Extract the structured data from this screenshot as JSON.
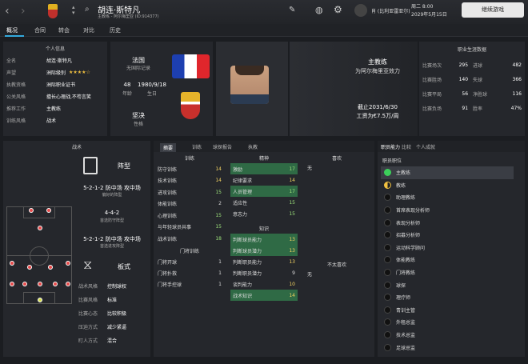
{
  "header": {
    "name": "胡连·斯特凡",
    "subtitle": "主教练 - 阿尔梅里亚 (ID:914377)",
    "date_line1": "周二 8:00",
    "date_line2": "2029年5月15日",
    "league": "肖 (比利亚雷亚尔)",
    "continue_button": "继续游戏"
  },
  "tabs": [
    "概况",
    "合同",
    "转会",
    "对比",
    "历史"
  ],
  "info": {
    "title": "个人信息",
    "rows": [
      {
        "label": "全名",
        "value": "胡连·斯特凡"
      },
      {
        "label": "声望",
        "value": "洲际级别"
      },
      {
        "label": "执教资格",
        "value": "洲际职业证书"
      },
      {
        "label": "公关风格",
        "value": "擅长心理战,不苟言笑"
      },
      {
        "label": "推荐工作",
        "value": "主教练"
      },
      {
        "label": "训练风格",
        "value": "战术"
      }
    ],
    "stars": "★★★★☆"
  },
  "bio": {
    "nationality": "法国",
    "nationality_sub": "无国际记录",
    "age_value": "48",
    "age_label": "年龄",
    "birth_value": "1980/9/18",
    "birth_label": "生日",
    "personality_value": "坚决",
    "personality_label": "性格"
  },
  "contract": {
    "role": "主教练",
    "club": "为阿尔梅里亚效力",
    "expiry": "截止2031/6/30",
    "wage": "工资为€7.5万/周"
  },
  "career": {
    "title": "职业生涯数据",
    "rows": [
      {
        "l1": "比赛场次",
        "v1": "295",
        "l2": "进球",
        "v2": "482"
      },
      {
        "l1": "比赛胜场",
        "v1": "140",
        "l2": "失球",
        "v2": "366"
      },
      {
        "l1": "比赛平局",
        "v1": "56",
        "l2": "净胜球",
        "v2": "116"
      },
      {
        "l1": "比赛负场",
        "v1": "91",
        "l2": "胜率",
        "v2": "47%"
      }
    ]
  },
  "tactics": {
    "title": "战术",
    "formation_label": "阵型",
    "preferred": "5-2-1-2 防中场 攻中场",
    "preferred_sub": "偏好的阵型",
    "defensive": "4-4-2",
    "defensive_sub": "首选防守阵型",
    "attacking": "5-2-1-2 防中场 攻中场",
    "attacking_sub": "首选进攻阵型",
    "style_label": "板式",
    "styles": [
      {
        "label": "战术风格",
        "value": "控制球权"
      },
      {
        "label": "比赛风格",
        "value": "标准"
      },
      {
        "label": "比赛心态",
        "value": "比较积极"
      },
      {
        "label": "压迫方式",
        "value": "减少紧逼"
      },
      {
        "label": "盯人方式",
        "value": "混合"
      }
    ]
  },
  "attr_tabs": [
    "摘要",
    "训练",
    "球探报告",
    "执教"
  ],
  "training": {
    "title": "训练",
    "rows": [
      {
        "label": "防守训练",
        "value": "14"
      },
      {
        "label": "技术训练",
        "value": "14"
      },
      {
        "label": "进攻训练",
        "value": "15"
      },
      {
        "label": "体能训练",
        "value": "2"
      },
      {
        "label": "心理训练",
        "value": "15"
      },
      {
        "label": "与年轻球员共事",
        "value": "15"
      },
      {
        "label": "战术训练",
        "value": "18"
      }
    ],
    "gk_title": "门将训练",
    "gk_rows": [
      {
        "label": "门将开球",
        "value": "1"
      },
      {
        "label": "门将扑救",
        "value": "1"
      },
      {
        "label": "门将手控球",
        "value": "1"
      }
    ]
  },
  "mental": {
    "title": "精神",
    "rows": [
      {
        "label": "激励",
        "value": "17"
      },
      {
        "label": "纪律要求",
        "value": "14"
      },
      {
        "label": "人员管理",
        "value": "17"
      },
      {
        "label": "适应性",
        "value": "15"
      },
      {
        "label": "意志力",
        "value": "15"
      }
    ],
    "knowledge_title": "知识",
    "knowledge_rows": [
      {
        "label": "判断球员能力",
        "value": "13"
      },
      {
        "label": "判断球员潜力",
        "value": "13"
      },
      {
        "label": "判断职员能力",
        "value": "13"
      },
      {
        "label": "判断职员潜力",
        "value": "9"
      },
      {
        "label": "谈判能力",
        "value": "10"
      },
      {
        "label": "战术知识",
        "value": "14"
      }
    ]
  },
  "likes": {
    "title": "喜欢",
    "value": "无",
    "dislikes_title": "不太喜欢",
    "dislikes_value": "无"
  },
  "roles": {
    "tabs": [
      "职员能力",
      "比较",
      "个人成就"
    ],
    "title": "职员职位",
    "items": [
      "主教练",
      "教练",
      "助理教练",
      "首席表现分析师",
      "表现分析师",
      "招募分析师",
      "运动科学顾问",
      "体能教练",
      "门将教练",
      "球探",
      "理疗师",
      "青训主管",
      "外租总监",
      "技术总监",
      "足球总监"
    ]
  }
}
